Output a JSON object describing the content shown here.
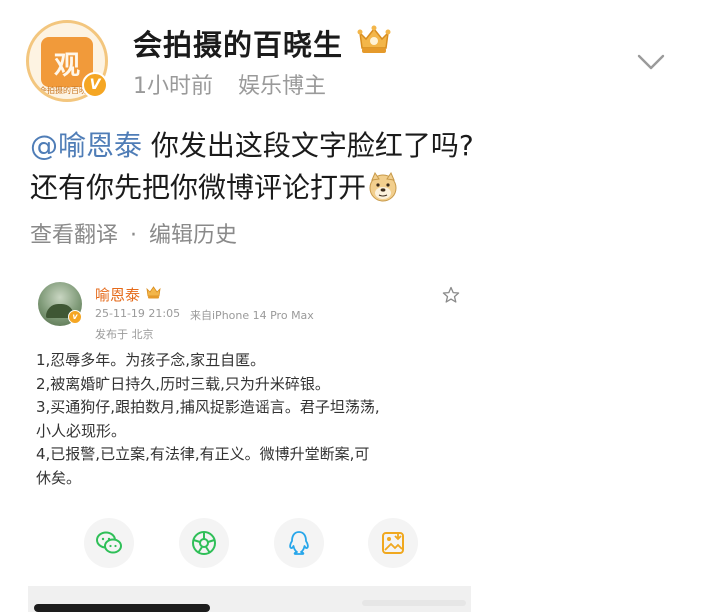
{
  "header": {
    "avatar_text": "观",
    "avatar_caption": "会拍摄的百晓生",
    "nickname": "会拍摄的百晓生",
    "time": "1小时前",
    "label": "娱乐博主"
  },
  "post": {
    "mention": "@喻恩泰",
    "line1_rest": " 你发出这段文字脸红了吗?",
    "line2": "还有你先把你微博评论打开",
    "translate": "查看翻译",
    "separator": "·",
    "edit_history": "编辑历史"
  },
  "embedded": {
    "name": "喻恩泰",
    "time": "25-11-19 21:05",
    "source": "来自iPhone 14 Pro Max",
    "location": "发布于 北京",
    "lines": [
      "1,忍辱多年。为孩子念,家丑自匿。",
      "2,被离婚旷日持久,历时三载,只为升米碎银。",
      "3,买通狗仔,跟拍数月,捕风捉影造谣言。君子坦荡荡,",
      "小人必现形。",
      "4,已报警,已立案,有法律,有正义。微博升堂断案,可",
      "休矣。"
    ],
    "share_icons": [
      "wechat-icon",
      "moments-icon",
      "qq-icon",
      "save-image-icon"
    ]
  },
  "colors": {
    "mention": "#4f7db7",
    "embedded_name": "#e56a1a",
    "vip_badge": "#f5a623",
    "wechat": "#2fbf58",
    "qq": "#27a6ea",
    "save": "#f0a81f"
  }
}
